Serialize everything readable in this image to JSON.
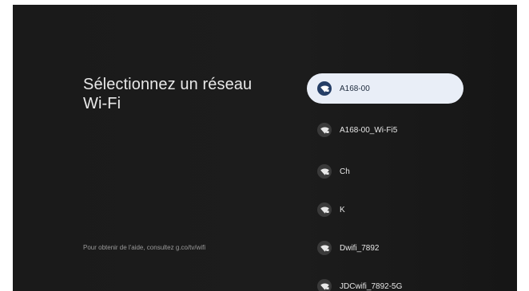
{
  "title": {
    "line1": "Sélectionnez un réseau",
    "line2": "Wi-Fi"
  },
  "help_text": "Pour obtenir de l'aide, consultez g.co/tv/wifi",
  "networks": [
    {
      "name": "A168-00",
      "icon": "wifi-lock-icon",
      "focused": true
    },
    {
      "name": "A168-00_Wi-Fi5",
      "icon": "wifi-lock-icon",
      "focused": false
    },
    {
      "name": "Ch",
      "icon": "wifi-lock-icon",
      "focused": false
    },
    {
      "name": "K",
      "icon": "wifi-lock-icon",
      "focused": false
    },
    {
      "name": "Dwifi_7892",
      "icon": "wifi-lock-icon",
      "focused": false
    },
    {
      "name": "JDCwifi_7892-5G",
      "icon": "wifi-lock-icon",
      "focused": false
    }
  ],
  "colors": {
    "background": "#1a1a1a",
    "focus_pill": "#e9eef7",
    "focus_icon_bg": "#253e66"
  }
}
